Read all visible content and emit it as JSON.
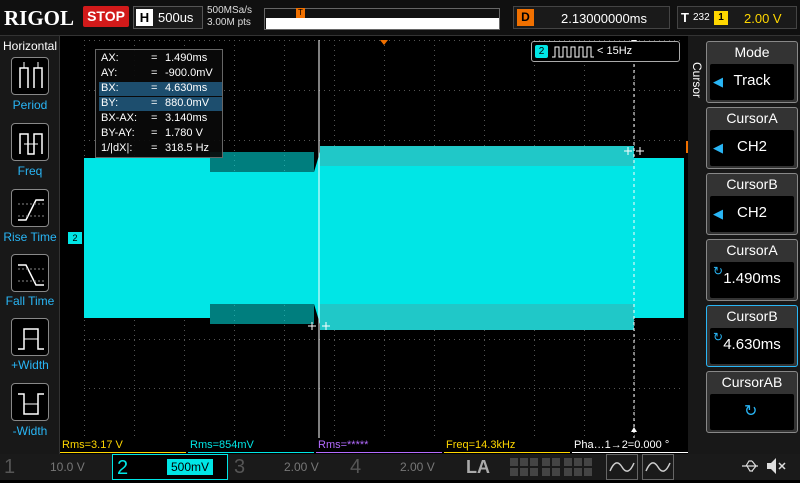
{
  "header": {
    "brand": "RIGOL",
    "run_state": "STOP",
    "h_label": "H",
    "timebase": "500us",
    "sample_rate": "500MSa/s",
    "memory_depth": "3.00M pts",
    "trigger_marker": "T",
    "d_label": "D",
    "delay": "2.13000000ms",
    "t_label": "T",
    "trigger_type": "232",
    "trigger_channel": "1",
    "trigger_level": "2.00 V"
  },
  "left_panel": {
    "title": "Horizontal",
    "items": [
      {
        "label": "Period",
        "icon": "period-icon"
      },
      {
        "label": "Freq",
        "icon": "freq-icon"
      },
      {
        "label": "Rise Time",
        "icon": "rise-time-icon"
      },
      {
        "label": "Fall Time",
        "icon": "fall-time-icon"
      },
      {
        "label": "+Width",
        "icon": "pos-width-icon"
      },
      {
        "label": "-Width",
        "icon": "neg-width-icon"
      }
    ]
  },
  "cursor_info": {
    "rows": [
      {
        "key": "AX:",
        "value": "1.490ms",
        "highlight": false
      },
      {
        "key": "AY:",
        "value": "-900.0mV",
        "highlight": false
      },
      {
        "key": "BX:",
        "value": "4.630ms",
        "highlight": true
      },
      {
        "key": "BY:",
        "value": "880.0mV",
        "highlight": true
      },
      {
        "key": "BX-AX:",
        "value": "3.140ms",
        "highlight": false
      },
      {
        "key": "BY-AY:",
        "value": "1.780 V",
        "highlight": false
      },
      {
        "key": "1/|dX|:",
        "value": "318.5 Hz",
        "highlight": false
      }
    ],
    "eq": "="
  },
  "freq_counter": {
    "channel": "2",
    "value": "< 15Hz"
  },
  "markers": {
    "ch2_ground": "2",
    "trigger_level": "T"
  },
  "right_panel": {
    "vertical_title": "Cursor",
    "buttons": [
      {
        "title": "Mode",
        "value": "Track",
        "icon": "left-arrow-icon"
      },
      {
        "title": "CursorA",
        "value": "CH2",
        "icon": "left-arrow-icon"
      },
      {
        "title": "CursorB",
        "value": "CH2",
        "icon": "left-arrow-icon"
      },
      {
        "title": "CursorA",
        "value": "1.490ms",
        "icon": "knob-icon"
      },
      {
        "title": "CursorB",
        "value": "4.630ms",
        "icon": "knob-icon"
      },
      {
        "title": "CursorAB",
        "value": "",
        "icon": "knob-icon"
      }
    ]
  },
  "measurements": [
    {
      "text": "Rms=3.17 V",
      "color": "#ffd700"
    },
    {
      "text": "Rms=854mV",
      "color": "#00e6e6"
    },
    {
      "text": "Rms=*****",
      "color": "#b36bff"
    },
    {
      "text": "Freq=14.3kHz",
      "color": "#ffd700"
    },
    {
      "text": "Pha…1→2=0.000 °",
      "color": "#ffffff"
    }
  ],
  "channels": [
    {
      "num": "1",
      "scale": "10.0 V",
      "color": "#ffd700",
      "active": false
    },
    {
      "num": "2",
      "scale": "500mV",
      "color": "#00e6e6",
      "active": true
    },
    {
      "num": "3",
      "scale": "2.00 V",
      "color": "#e060e0",
      "active": false
    },
    {
      "num": "4",
      "scale": "2.00 V",
      "color": "#3090ff",
      "active": false
    }
  ],
  "la_label": "LA",
  "colors": {
    "ch2": "#00e6e6",
    "accent_orange": "#f07000",
    "label_blue": "#29b6f6"
  }
}
